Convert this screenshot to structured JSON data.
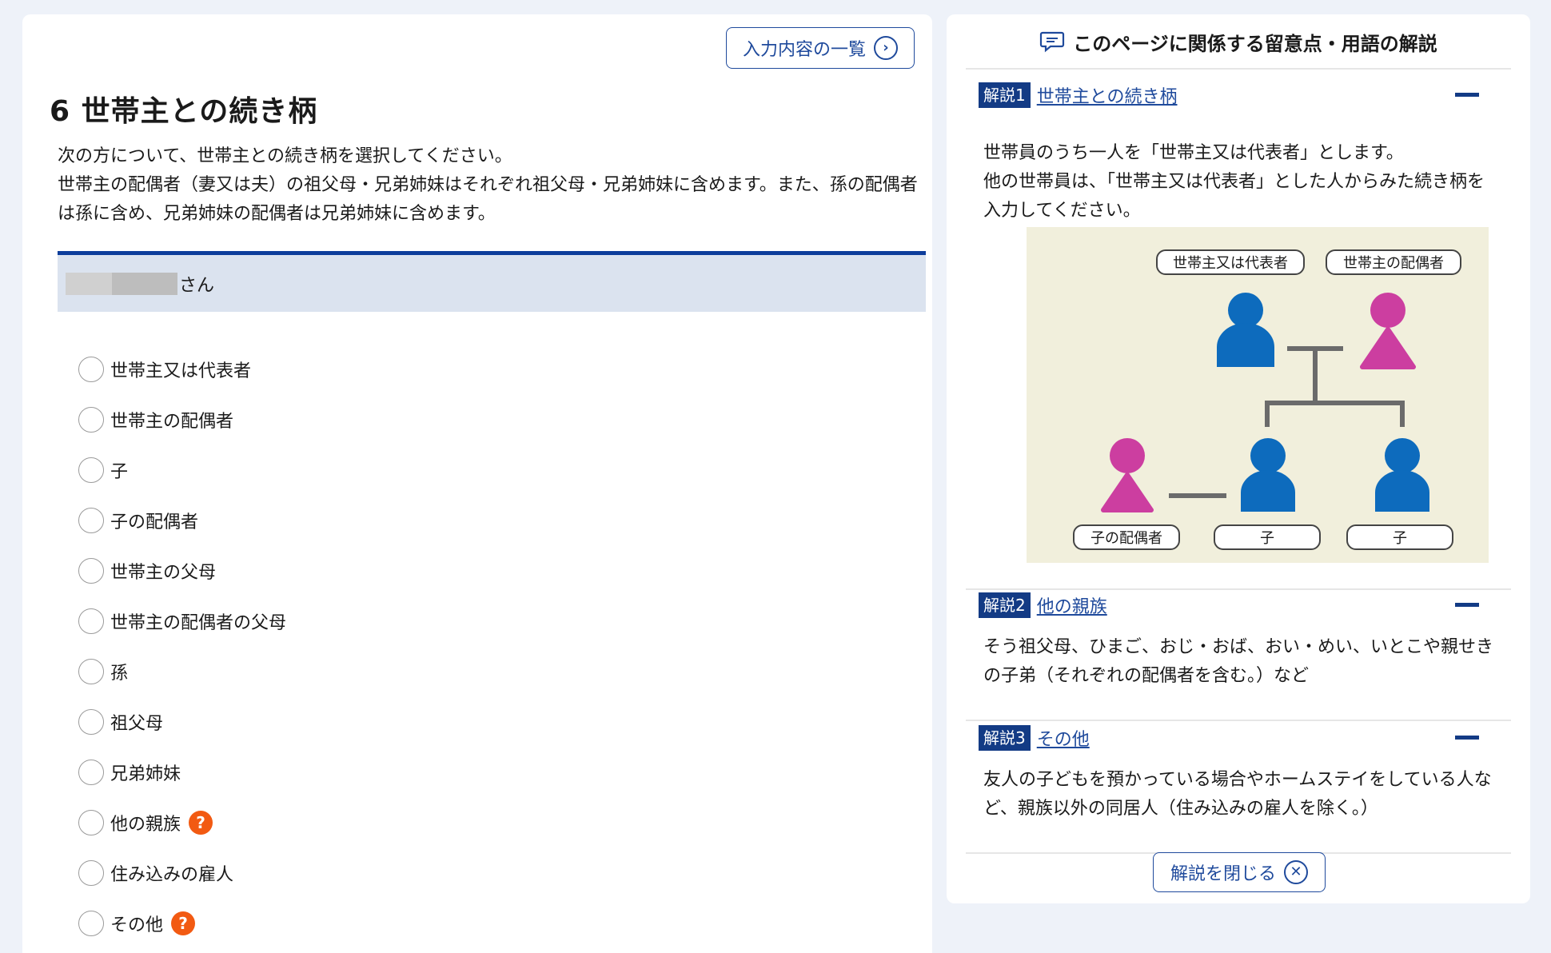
{
  "toolbar": {
    "summary_label": "入力内容の一覧"
  },
  "page": {
    "title": "6 世帯主との続き柄",
    "lead_lines": [
      "次の方について、世帯主との続き柄を選択してください。",
      "世帯主の配偶者（妻又は夫）の祖父母・兄弟姉妹はそれぞれ祖父母・兄弟姉妹に含めます。また、孫の配偶者は孫に含め、兄弟姉妹の配偶者は兄弟姉妹に含めます。"
    ],
    "person_suffix": "さん"
  },
  "options": [
    {
      "label": "世帯主又は代表者",
      "help": false
    },
    {
      "label": "世帯主の配偶者",
      "help": false
    },
    {
      "label": "子",
      "help": false
    },
    {
      "label": "子の配偶者",
      "help": false
    },
    {
      "label": "世帯主の父母",
      "help": false
    },
    {
      "label": "世帯主の配偶者の父母",
      "help": false
    },
    {
      "label": "孫",
      "help": false
    },
    {
      "label": "祖父母",
      "help": false
    },
    {
      "label": "兄弟姉妹",
      "help": false
    },
    {
      "label": "他の親族",
      "help": true
    },
    {
      "label": "住み込みの雇人",
      "help": false
    },
    {
      "label": "その他",
      "help": true
    }
  ],
  "help_glyph": "?",
  "panel": {
    "title": "このページに関係する留意点・用語の解説",
    "sections": [
      {
        "badge": "解説1",
        "link": "世帯主との続き柄",
        "lines": [
          "世帯員のうち一人を「世帯主又は代表者」とします。",
          "他の世帯員は、「世帯主又は代表者」とした人からみた続き柄を入力してください。"
        ]
      },
      {
        "badge": "解説2",
        "link": "他の親族",
        "lines": [
          "そう祖父母、ひまご、おじ・おば、おい・めい、いとこや親せきの子弟（それぞれの配偶者を含む。）など"
        ]
      },
      {
        "badge": "解説3",
        "link": "その他",
        "lines": [
          "友人の子どもを預かっている場合やホームステイをしている人など、親族以外の同居人（住み込みの雇人を除く。）"
        ]
      }
    ],
    "diagram_labels": {
      "head": "世帯主又は代表者",
      "spouse": "世帯主の配偶者",
      "child_spouse": "子の配偶者",
      "child1": "子",
      "child2": "子"
    },
    "close_label": "解説を閉じる"
  },
  "colors": {
    "accent": "#1f4a9c",
    "navy": "#133b85",
    "male": "#0d6bbd",
    "female": "#cc3ea0",
    "help": "#f25a12",
    "diagram_bg": "#f1efdc"
  },
  "icons": [
    "chevron-right-icon",
    "help-icon",
    "comment-icon",
    "collapse-minus-icon",
    "close-x-icon",
    "male-person-icon",
    "female-person-icon"
  ]
}
